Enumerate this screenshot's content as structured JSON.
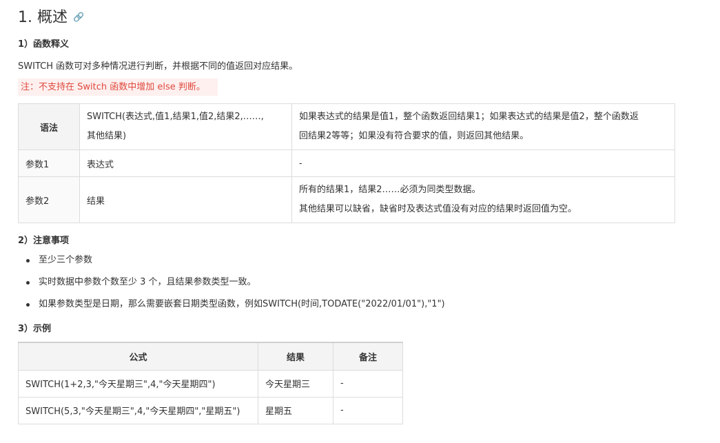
{
  "section": {
    "title": "1. 概述",
    "anchor_icon": "link-icon"
  },
  "definition": {
    "heading": "1）函数释义",
    "description": "SWITCH 函数可对多种情况进行判断，并根据不同的值返回对应结果。",
    "note": "注：不支持在 Switch 函数中增加 else 判断。",
    "table": {
      "syntax_label": "语法",
      "syntax_line1": "SWITCH(表达式,值1,结果1,值2,结果2,……,",
      "syntax_line2": "其他结果)",
      "syntax_desc_line1": "如果表达式的结果是值1，整个函数返回结果1；如果表达式的结果是值2，整个函数返",
      "syntax_desc_line2": "回结果2等等；如果没有符合要求的值，则返回其他结果。",
      "param1_label": "参数1",
      "param1_name": "表达式",
      "param1_desc": "-",
      "param2_label": "参数2",
      "param2_name": "结果",
      "param2_desc_line1": "所有的结果1，结果2……必须为同类型数据。",
      "param2_desc_line2": "其他结果可以缺省，缺省时及表达式值没有对应的结果时返回值为空。"
    }
  },
  "notes": {
    "heading": "2）注意事项",
    "items": [
      "至少三个参数",
      "实时数据中参数个数至少 3 个，且结果参数类型一致。",
      "如果参数类型是日期，那么需要嵌套日期类型函数，例如SWITCH(时间,TODATE(\"2022/01/01\"),\"1\")"
    ]
  },
  "example": {
    "heading": "3）示例",
    "columns": [
      "公式",
      "结果",
      "备注"
    ],
    "rows": [
      [
        "SWITCH(1+2,3,\"今天星期三\",4,\"今天星期四\")",
        "今天星期三",
        "-"
      ],
      [
        "SWITCH(5,3,\"今天星期三\",4,\"今天星期四\",\"星期五\")",
        "星期五",
        "-"
      ]
    ]
  },
  "colors": {
    "note_text": "#e0493e",
    "note_bg": "#fdf0ef",
    "table_border": "#dcdcdc",
    "header_bg": "#f4f4f4"
  }
}
